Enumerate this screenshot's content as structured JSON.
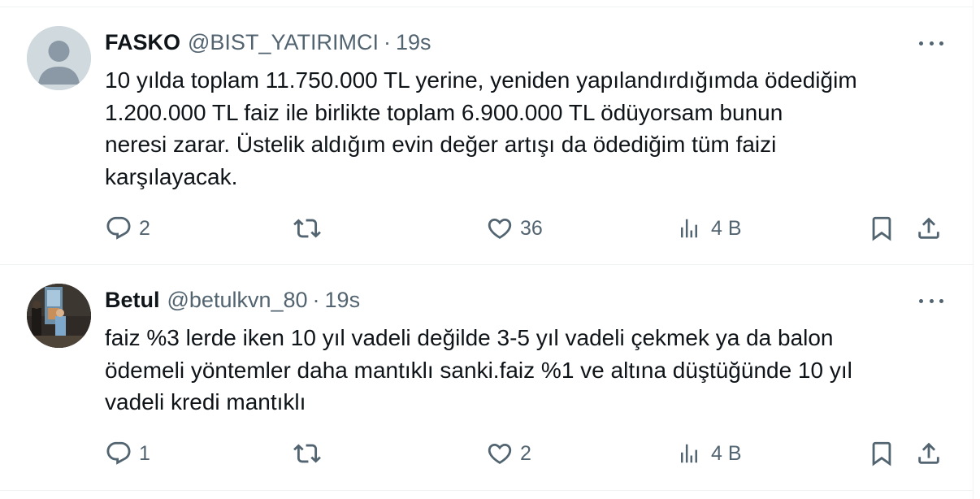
{
  "tweets": [
    {
      "name": "FASKO",
      "handle": "@BIST_YATIRIMCI",
      "separator": "·",
      "time": "19s",
      "text": "10 yılda toplam 11.750.000 TL yerine, yeniden yapılandırdığımda ödediğim\n1.200.000 TL faiz ile birlikte toplam  6.900.000 TL ödüyorsam bunun\nneresi zarar. Üstelik aldığım evin değer artışı da ödediğim tüm faizi\nkarşılayacak.",
      "replies": "2",
      "retweets": "",
      "likes": "36",
      "views": "4 B"
    },
    {
      "name": "Betul",
      "handle": "@betulkvn_80",
      "separator": "·",
      "time": "19s",
      "text": "faiz %3 lerde iken 10 yıl vadeli değilde 3-5 yıl vadeli çekmek ya da balon\nödemeli yöntemler daha mantıklı sanki.faiz %1 ve altına düştüğünde 10 yıl\nvadeli kredi mantıklı",
      "replies": "1",
      "retweets": "",
      "likes": "2",
      "views": "4 B"
    }
  ],
  "colors": {
    "text": "#0f1419",
    "secondary": "#536471",
    "border": "#eff3f4",
    "default_avatar": "#cfd9de"
  },
  "icons": [
    "reply-icon",
    "retweet-icon",
    "like-icon",
    "views-icon",
    "bookmark-icon",
    "share-icon",
    "more-icon"
  ]
}
